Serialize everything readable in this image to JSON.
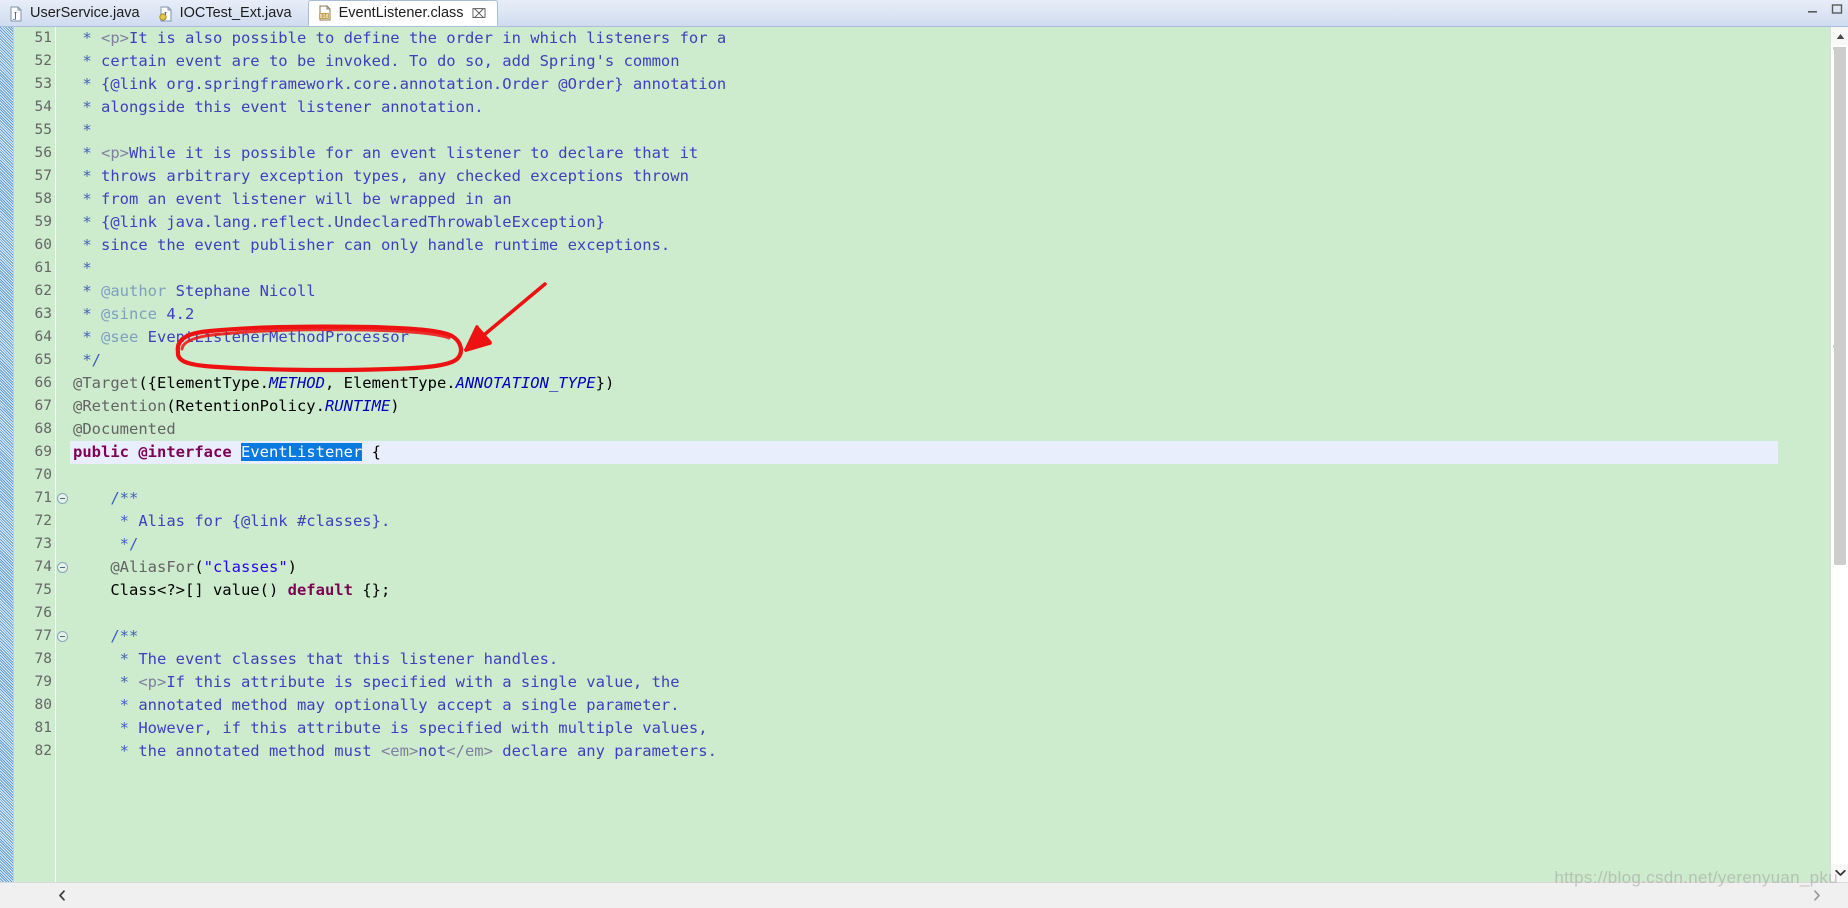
{
  "window": {
    "minimize_label": "–",
    "maximize_label": "□"
  },
  "tabs": [
    {
      "label": "UserService.java",
      "icon": "java-file-icon",
      "active": false,
      "closable": false
    },
    {
      "label": "IOCTest_Ext.java",
      "icon": "java-file-icon",
      "active": false,
      "closable": false
    },
    {
      "label": "EventListener.class",
      "icon": "class-file-icon",
      "active": true,
      "closable": true,
      "close_label": "⌧"
    }
  ],
  "editor": {
    "first_line": 51,
    "current_line": 69,
    "fold_lines": [
      71,
      74,
      77
    ],
    "lines": [
      {
        "n": 51,
        "tokens": [
          {
            "t": "cmt-star",
            "v": " * "
          },
          {
            "t": "html",
            "v": "<p>"
          },
          {
            "t": "cmt",
            "v": "It is also possible to define the order in which listeners for a"
          }
        ]
      },
      {
        "n": 52,
        "tokens": [
          {
            "t": "cmt-star",
            "v": " * "
          },
          {
            "t": "cmt",
            "v": "certain event are to be invoked. To do so, add Spring's common"
          }
        ]
      },
      {
        "n": 53,
        "tokens": [
          {
            "t": "cmt-star",
            "v": " * "
          },
          {
            "t": "cmt",
            "v": "{@link org.springframework.core.annotation.Order @Order} annotation"
          }
        ]
      },
      {
        "n": 54,
        "tokens": [
          {
            "t": "cmt-star",
            "v": " * "
          },
          {
            "t": "cmt",
            "v": "alongside this event listener annotation."
          }
        ]
      },
      {
        "n": 55,
        "tokens": [
          {
            "t": "cmt-star",
            "v": " *"
          }
        ]
      },
      {
        "n": 56,
        "tokens": [
          {
            "t": "cmt-star",
            "v": " * "
          },
          {
            "t": "html",
            "v": "<p>"
          },
          {
            "t": "cmt",
            "v": "While it is possible for an event listener to declare that it"
          }
        ]
      },
      {
        "n": 57,
        "tokens": [
          {
            "t": "cmt-star",
            "v": " * "
          },
          {
            "t": "cmt",
            "v": "throws arbitrary exception types, any checked exceptions thrown"
          }
        ]
      },
      {
        "n": 58,
        "tokens": [
          {
            "t": "cmt-star",
            "v": " * "
          },
          {
            "t": "cmt",
            "v": "from an event listener will be wrapped in an"
          }
        ]
      },
      {
        "n": 59,
        "tokens": [
          {
            "t": "cmt-star",
            "v": " * "
          },
          {
            "t": "cmt",
            "v": "{@link java.lang.reflect.UndeclaredThrowableException}"
          }
        ]
      },
      {
        "n": 60,
        "tokens": [
          {
            "t": "cmt-star",
            "v": " * "
          },
          {
            "t": "cmt",
            "v": "since the event publisher can only handle runtime exceptions."
          }
        ]
      },
      {
        "n": 61,
        "tokens": [
          {
            "t": "cmt-star",
            "v": " *"
          }
        ]
      },
      {
        "n": 62,
        "tokens": [
          {
            "t": "cmt-star",
            "v": " * "
          },
          {
            "t": "cmt-tag",
            "v": "@author "
          },
          {
            "t": "cmt",
            "v": "Stephane Nicoll"
          }
        ]
      },
      {
        "n": 63,
        "tokens": [
          {
            "t": "cmt-star",
            "v": " * "
          },
          {
            "t": "cmt-tag",
            "v": "@since "
          },
          {
            "t": "cmt",
            "v": "4.2"
          }
        ]
      },
      {
        "n": 64,
        "tokens": [
          {
            "t": "cmt-star",
            "v": " * "
          },
          {
            "t": "cmt-tag",
            "v": "@see "
          },
          {
            "t": "cmt",
            "v": "EventListenerMethodProcessor"
          }
        ]
      },
      {
        "n": 65,
        "tokens": [
          {
            "t": "cmt-star",
            "v": " */"
          }
        ]
      },
      {
        "n": 66,
        "tokens": [
          {
            "t": "ann",
            "v": "@Target"
          },
          {
            "t": "plain",
            "v": "({ElementType."
          },
          {
            "t": "static",
            "v": "METHOD"
          },
          {
            "t": "plain",
            "v": ", ElementType."
          },
          {
            "t": "static",
            "v": "ANNOTATION_TYPE"
          },
          {
            "t": "plain",
            "v": "})"
          }
        ]
      },
      {
        "n": 67,
        "tokens": [
          {
            "t": "ann",
            "v": "@Retention"
          },
          {
            "t": "plain",
            "v": "(RetentionPolicy."
          },
          {
            "t": "static",
            "v": "RUNTIME"
          },
          {
            "t": "plain",
            "v": ")"
          }
        ]
      },
      {
        "n": 68,
        "tokens": [
          {
            "t": "ann",
            "v": "@Documented"
          }
        ]
      },
      {
        "n": 69,
        "tokens": [
          {
            "t": "kw",
            "v": "public "
          },
          {
            "t": "kw",
            "v": "@interface"
          },
          {
            "t": "plain",
            "v": " "
          },
          {
            "t": "sel",
            "v": "EventListener"
          },
          {
            "t": "plain",
            "v": " {"
          }
        ]
      },
      {
        "n": 70,
        "tokens": []
      },
      {
        "n": 71,
        "tokens": [
          {
            "t": "cmt-star",
            "v": "    /**"
          }
        ]
      },
      {
        "n": 72,
        "tokens": [
          {
            "t": "cmt-star",
            "v": "     * "
          },
          {
            "t": "cmt",
            "v": "Alias for {@link #classes}."
          }
        ]
      },
      {
        "n": 73,
        "tokens": [
          {
            "t": "cmt-star",
            "v": "     */"
          }
        ]
      },
      {
        "n": 74,
        "tokens": [
          {
            "t": "plain",
            "v": "    "
          },
          {
            "t": "ann",
            "v": "@AliasFor"
          },
          {
            "t": "plain",
            "v": "("
          },
          {
            "t": "str",
            "v": "\"classes\""
          },
          {
            "t": "plain",
            "v": ")"
          }
        ]
      },
      {
        "n": 75,
        "tokens": [
          {
            "t": "plain",
            "v": "    Class<?>[] value() "
          },
          {
            "t": "kw",
            "v": "default"
          },
          {
            "t": "plain",
            "v": " {};"
          }
        ]
      },
      {
        "n": 76,
        "tokens": []
      },
      {
        "n": 77,
        "tokens": [
          {
            "t": "cmt-star",
            "v": "    /**"
          }
        ]
      },
      {
        "n": 78,
        "tokens": [
          {
            "t": "cmt-star",
            "v": "     * "
          },
          {
            "t": "cmt",
            "v": "The event classes that this listener handles."
          }
        ]
      },
      {
        "n": 79,
        "tokens": [
          {
            "t": "cmt-star",
            "v": "     * "
          },
          {
            "t": "html",
            "v": "<p>"
          },
          {
            "t": "cmt",
            "v": "If this attribute is specified with a single value, the"
          }
        ]
      },
      {
        "n": 80,
        "tokens": [
          {
            "t": "cmt-star",
            "v": "     * "
          },
          {
            "t": "cmt",
            "v": "annotated method may optionally accept a single parameter."
          }
        ]
      },
      {
        "n": 81,
        "tokens": [
          {
            "t": "cmt-star",
            "v": "     * "
          },
          {
            "t": "cmt",
            "v": "However, if this attribute is specified with multiple values,"
          }
        ]
      },
      {
        "n": 82,
        "tokens": [
          {
            "t": "cmt-star",
            "v": "     * "
          },
          {
            "t": "cmt",
            "v": "the annotated method must "
          },
          {
            "t": "html",
            "v": "<em>"
          },
          {
            "t": "cmt",
            "v": "not"
          },
          {
            "t": "html",
            "v": "</em>"
          },
          {
            "t": "cmt",
            "v": " declare any parameters."
          }
        ]
      }
    ]
  },
  "annotations": {
    "ellipse_label": "red-ellipse-around-EventListenerMethodProcessor",
    "arrow_label": "red-arrow-pointing-to-EventListenerMethodProcessor"
  },
  "scrollbars": {
    "v_up_label": "▲",
    "v_down_label": "▼",
    "h_left_label": "◀",
    "h_right_label": "▶"
  },
  "watermark": {
    "text": "https://blog.csdn.net/yerenyuan_pku"
  },
  "colors": {
    "editor_background": "#cdebcd",
    "current_line": "#e8eefb",
    "selection": "#0a7ae0",
    "comment": "#3f3fbf",
    "keyword": "#7f0055",
    "string": "#2a00ff",
    "annotation": "#646464",
    "static_field": "#0000c0",
    "marker_red": "#ee1111"
  }
}
